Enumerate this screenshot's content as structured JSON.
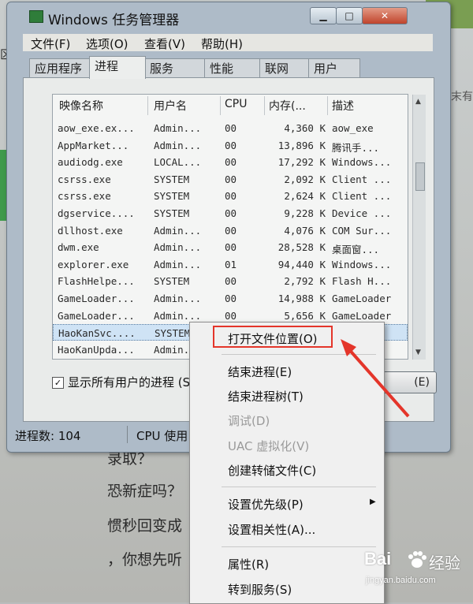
{
  "background": {
    "left_char": "区",
    "right_char": "末有",
    "lines": [
      "录取？",
      "恐新症吗？",
      "惯秒回变成",
      "，你想先听"
    ]
  },
  "window": {
    "title": "Windows 任务管理器",
    "menu": [
      "文件(F)",
      "选项(O)",
      "查看(V)",
      "帮助(H)"
    ],
    "tabs": [
      "应用程序",
      "进程",
      "服务",
      "性能",
      "联网",
      "用户"
    ],
    "active_tab": "进程"
  },
  "process_table": {
    "columns": [
      "映像名称",
      "用户名",
      "CPU",
      "内存(...",
      "描述"
    ],
    "rows": [
      {
        "name": "aow_exe.ex...",
        "user": "Admin...",
        "cpu": "00",
        "mem": "4,360 K",
        "desc": "aow_exe"
      },
      {
        "name": "AppMarket...",
        "user": "Admin...",
        "cpu": "00",
        "mem": "13,896 K",
        "desc": "腾讯手..."
      },
      {
        "name": "audiodg.exe",
        "user": "LOCAL...",
        "cpu": "00",
        "mem": "17,292 K",
        "desc": "Windows..."
      },
      {
        "name": "csrss.exe",
        "user": "SYSTEM",
        "cpu": "00",
        "mem": "2,092 K",
        "desc": "Client ..."
      },
      {
        "name": "csrss.exe",
        "user": "SYSTEM",
        "cpu": "00",
        "mem": "2,624 K",
        "desc": "Client ..."
      },
      {
        "name": "dgservice....",
        "user": "SYSTEM",
        "cpu": "00",
        "mem": "9,228 K",
        "desc": "Device ..."
      },
      {
        "name": "dllhost.exe",
        "user": "Admin...",
        "cpu": "00",
        "mem": "4,076 K",
        "desc": "COM Sur..."
      },
      {
        "name": "dwm.exe",
        "user": "Admin...",
        "cpu": "00",
        "mem": "28,528 K",
        "desc": "桌面窗..."
      },
      {
        "name": "explorer.exe",
        "user": "Admin...",
        "cpu": "01",
        "mem": "94,440 K",
        "desc": "Windows..."
      },
      {
        "name": "FlashHelpe...",
        "user": "SYSTEM",
        "cpu": "00",
        "mem": "2,792 K",
        "desc": "Flash H..."
      },
      {
        "name": "GameLoader...",
        "user": "Admin...",
        "cpu": "00",
        "mem": "14,988 K",
        "desc": "GameLoader"
      },
      {
        "name": "GameLoader...",
        "user": "Admin...",
        "cpu": "00",
        "mem": "5,656 K",
        "desc": "GameLoader"
      },
      {
        "name": "HaoKanSvc....",
        "user": "SYSTEM",
        "cpu": "",
        "mem": "",
        "desc": ""
      },
      {
        "name": "HaoKanUpda...",
        "user": "Admin...",
        "cpu": "",
        "mem": "",
        "desc": ""
      }
    ],
    "selected_row": 12
  },
  "show_all_users": {
    "label": "显示所有用户的进程 (S",
    "checked": true
  },
  "end_process_button": "(E)",
  "status": {
    "processes": "进程数: 104",
    "cpu": "CPU 使用"
  },
  "context_menu": {
    "items": [
      {
        "label": "打开文件位置(O)",
        "disabled": false
      },
      {
        "label": "结束进程(E)",
        "disabled": false
      },
      {
        "label": "结束进程树(T)",
        "disabled": false
      },
      {
        "label": "调试(D)",
        "disabled": true
      },
      {
        "label": "UAC 虚拟化(V)",
        "disabled": true
      },
      {
        "label": "创建转储文件(C)",
        "disabled": false
      },
      {
        "label": "设置优先级(P)",
        "disabled": false
      },
      {
        "label": "设置相关性(A)...",
        "disabled": false
      },
      {
        "label": "属性(R)",
        "disabled": false
      },
      {
        "label": "转到服务(S)",
        "disabled": false
      }
    ]
  },
  "watermark": {
    "brand": "Bai",
    "product": "经验",
    "url": "jingyan.baidu.com"
  },
  "colors": {
    "annotation": "#e4352a",
    "selection": "#cfe3f5",
    "close_button": "#c0442c"
  },
  "icons": [
    "app-icon",
    "minimize-icon",
    "maximize-icon",
    "close-icon",
    "submenu-arrow-icon",
    "sort-arrow-icon",
    "paw-icon"
  ]
}
